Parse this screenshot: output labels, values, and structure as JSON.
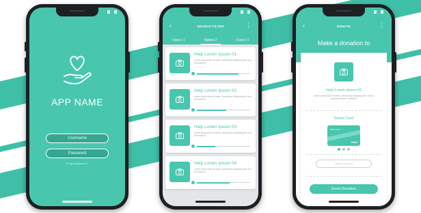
{
  "colors": {
    "accent": "#48c6ae",
    "accent_dark": "#36a693",
    "stripe": "#3fbfa8",
    "phone_body": "#1d1f22",
    "muted_text": "#9ca3a8"
  },
  "phone1": {
    "app_name": "APP NAME",
    "username_placeholder": "Username",
    "password_placeholder": "Password",
    "forgot_text": "Forgot password?",
    "logo_icon": "heart-in-hand-icon"
  },
  "phone2": {
    "title": "SEARCH FILTER",
    "tabs": [
      {
        "label": "Option 1",
        "active": false
      },
      {
        "label": "Option 2",
        "active": true
      },
      {
        "label": "Option 3",
        "active": false
      }
    ],
    "cards": [
      {
        "title": "Help Lorem Ipsum 01",
        "desc": "Lorem ipsum dolor sit amet, consectetur adipiscing elit, sed do eiusmod",
        "progress": 0.78,
        "icon": "camera-icon"
      },
      {
        "title": "Help Lorem Ipsum 02",
        "desc": "Lorem ipsum dolor sit amet, consectetur adipiscing elit, sed do eiusmod",
        "progress": 0.55,
        "icon": "camera-icon"
      },
      {
        "title": "Help Lorem Ipsum 03",
        "desc": "Lorem ipsum dolor sit amet, consectetur adipiscing elit, sed do eiusmod",
        "progress": 0.35,
        "icon": "camera-icon"
      },
      {
        "title": "Help Lorem Ipsum 04",
        "desc": "Lorem ipsum dolor sit amet, consectetur adipiscing elit, sed do eiusmod",
        "progress": 0.62,
        "icon": "camera-icon"
      }
    ]
  },
  "phone3": {
    "title": "DONATE",
    "headline": "Make a donation to",
    "org_name": "Help Lorem Ipsum 01",
    "org_desc": "Lorem ipsum dolor sit amet, consectetur adipiscing elit, sed do eiusmod tempor incididunt",
    "select_card_label": "Select Card",
    "card_brand": "VISA",
    "card_bank": "Bank name",
    "card_page": 1,
    "card_page_count": 3,
    "amount_placeholder": "Select Amount",
    "send_label": "Send Donation"
  }
}
